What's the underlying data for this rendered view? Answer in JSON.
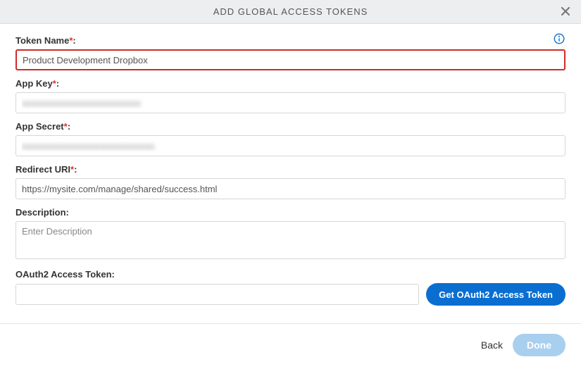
{
  "header": {
    "title": "ADD GLOBAL ACCESS TOKENS"
  },
  "fields": {
    "tokenName": {
      "label": "Token Name",
      "required": true,
      "value": "Product Development Dropbox"
    },
    "appKey": {
      "label": "App Key",
      "required": true,
      "value": "xxxxxxxxxxxxxxxxxxxxxxxxxx"
    },
    "appSecret": {
      "label": "App Secret",
      "required": true,
      "value": "xxxxxxxxxxxxxxxxxxxxxxxxxxxxx"
    },
    "redirectUri": {
      "label": "Redirect URI",
      "required": true,
      "value": "https://mysite.com/manage/shared/success.html"
    },
    "description": {
      "label": "Description",
      "required": false,
      "placeholder": "Enter Description",
      "value": ""
    },
    "oauthToken": {
      "label": "OAuth2 Access Token",
      "required": false,
      "value": ""
    }
  },
  "buttons": {
    "getToken": "Get OAuth2 Access Token",
    "back": "Back",
    "done": "Done"
  }
}
